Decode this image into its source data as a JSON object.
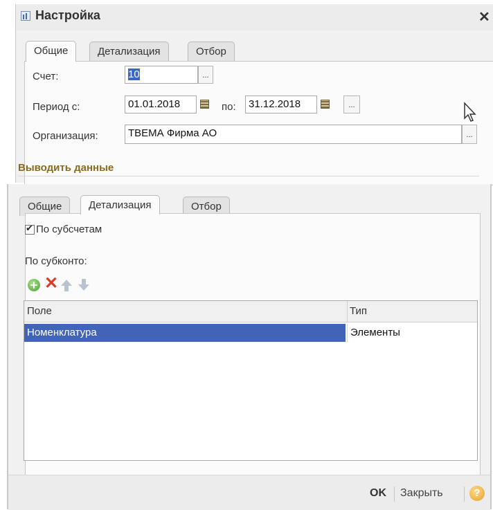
{
  "top_dialog": {
    "title": "Настройка",
    "close_glyph": "✕",
    "tabs": [
      "Общие",
      "Детализация",
      "Отбор"
    ],
    "active_tab": "Общие",
    "account_label": "Счет:",
    "account_value": "10",
    "period_from_label": "Период с:",
    "period_from_value": "01.01.2018",
    "period_to_label": "по:",
    "period_to_value": "31.12.2018",
    "organization_label": "Организация:",
    "organization_value": "ТВЕМА Фирма АО",
    "ellipsis": "...",
    "section_title": "Выводить данные"
  },
  "bottom_dialog": {
    "tabs": [
      "Общие",
      "Детализация",
      "Отбор"
    ],
    "active_tab": "Детализация",
    "by_subaccounts_label": "По субсчетам",
    "by_subaccounts_checked": true,
    "by_subkonto_label": "По субконто:",
    "table": {
      "columns": [
        "Поле",
        "Тип"
      ],
      "rows": [
        {
          "field": "Номенклатура",
          "type": "Элементы",
          "selected": true
        }
      ]
    },
    "footer": {
      "ok_label": "OK",
      "close_label": "Закрыть",
      "help_glyph": "?"
    }
  },
  "colors": {
    "selection": "#4264b8",
    "section_title": "#8a6a1d",
    "add_icon": "#49a12f",
    "delete_icon": "#d93b2b"
  }
}
